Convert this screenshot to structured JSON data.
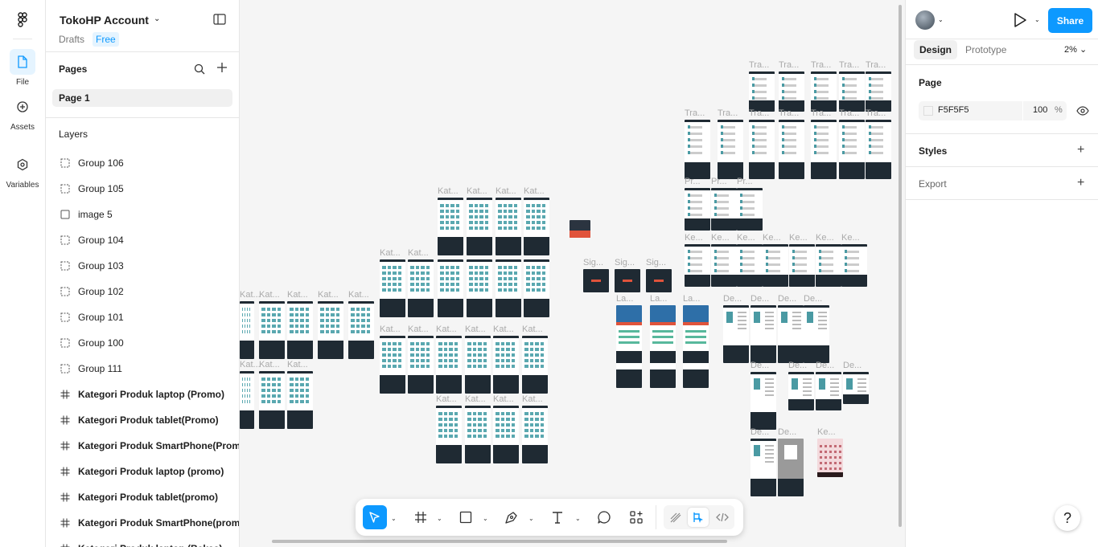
{
  "rail": {
    "items": [
      {
        "label": "File",
        "icon": "file-icon"
      },
      {
        "label": "Assets",
        "icon": "assets-icon"
      },
      {
        "label": "Variables",
        "icon": "variables-icon"
      }
    ]
  },
  "header": {
    "title": "TokoHP Account",
    "drafts": "Drafts",
    "plan": "Free"
  },
  "pages": {
    "heading": "Pages",
    "items": [
      "Page 1"
    ]
  },
  "layers": {
    "heading": "Layers",
    "items": [
      {
        "label": "Group 106",
        "type": "group"
      },
      {
        "label": "Group 105",
        "type": "group"
      },
      {
        "label": "image 5",
        "type": "image"
      },
      {
        "label": "Group 104",
        "type": "group"
      },
      {
        "label": "Group 103",
        "type": "group"
      },
      {
        "label": "Group 102",
        "type": "group"
      },
      {
        "label": "Group 101",
        "type": "group"
      },
      {
        "label": "Group 100",
        "type": "group"
      },
      {
        "label": "Group 111",
        "type": "group"
      },
      {
        "label": "Kategori Produk laptop (Promo)",
        "type": "frame"
      },
      {
        "label": "Kategori Produk tablet(Promo)",
        "type": "frame"
      },
      {
        "label": "Kategori Produk SmartPhone(Promo)",
        "type": "frame"
      },
      {
        "label": "Kategori Produk laptop (promo)",
        "type": "frame"
      },
      {
        "label": "Kategori Produk tablet(promo)",
        "type": "frame"
      },
      {
        "label": "Kategori Produk SmartPhone(promo)",
        "type": "frame"
      },
      {
        "label": "Kategori Produk laptop (Bekas)",
        "type": "frame"
      }
    ]
  },
  "right": {
    "share": "Share",
    "tabs": [
      "Design",
      "Prototype"
    ],
    "zoom": "2%",
    "page_heading": "Page",
    "bg_hex": "F5F5F5",
    "bg_opacity": "100",
    "pct": "%",
    "styles": "Styles",
    "export": "Export",
    "help": "?"
  },
  "canvas": {
    "labels": {
      "tra": "Tra...",
      "kat": "Kat...",
      "sig": "Sig...",
      "la": "La...",
      "de": "De...",
      "ke": "Ke...",
      "pr": "Pr..."
    }
  },
  "colors": {
    "accent": "#0d99ff",
    "canvas": "#F5F5F5",
    "frame_dark": "#1f2a33"
  }
}
